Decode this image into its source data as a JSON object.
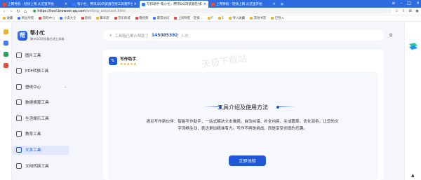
{
  "browser": {
    "tabs": [
      {
        "label": "上网导航 - 轻快上网 从这里开始",
        "active": false,
        "color": "#e94b35"
      },
      {
        "label": "帮小忙，腾讯QQ浏览器在线工具箱平台",
        "active": false,
        "color": "#3c7bff"
      },
      {
        "label": "写作助手-帮小忙，腾讯QQ浏览器在线工具",
        "active": true,
        "color": "#3c7bff"
      },
      {
        "label": "上网导航 - 轻快上网 从这里开始",
        "active": false,
        "color": "#e94b35"
      }
    ],
    "url_host": "https://tool.browser.qq.com",
    "url_path": "/writing_assistant.html",
    "bookmarks": [
      {
        "label": "收藏",
        "color": "#f2b12e"
      },
      {
        "label": "网址导航",
        "color": "#3c7bff"
      },
      {
        "label": "游戏中心",
        "color": "#e94b35"
      },
      {
        "label": "小说大全",
        "color": "#3c7bff"
      },
      {
        "label": "影视",
        "color": "#e94b35"
      },
      {
        "label": "聚享游",
        "color": "#f2b12e"
      },
      {
        "label": "京东商城",
        "color": "#e94b35"
      },
      {
        "label": "看视频",
        "color": "#e94b35"
      },
      {
        "label": "最常访问",
        "color": "#3c7bff"
      },
      {
        "label": "上网导航 - 轻快...",
        "color": "#e94b35"
      },
      {
        "label": "F",
        "color": "#f2b12e"
      },
      {
        "label": "1",
        "color": "#f2b12e"
      },
      {
        "label": "导入收藏",
        "color": "#f2b12e"
      },
      {
        "label": "其他书签",
        "color": "#f2b12e"
      },
      {
        "label": "已导入",
        "color": "#f2b12e"
      }
    ]
  },
  "brand": {
    "logo": "帮",
    "name": "帮小忙",
    "subtitle": "腾讯QQ浏览器在线工具箱"
  },
  "nav": [
    {
      "label": "图片工具",
      "active": false,
      "caret": false
    },
    {
      "label": "PDF转换工具",
      "active": false,
      "caret": false
    },
    {
      "label": "塑纸中心",
      "active": false,
      "caret": true
    },
    {
      "label": "数据换算工具",
      "active": false,
      "caret": false
    },
    {
      "label": "生活娱乐工具",
      "active": false,
      "caret": false
    },
    {
      "label": "教育工具",
      "active": false,
      "caret": false
    },
    {
      "label": "文本工具",
      "active": true,
      "caret": false
    },
    {
      "label": "文档转换工具",
      "active": false,
      "caret": false
    }
  ],
  "search": {
    "prefix": "工具箱已累计帮助了",
    "count": "145085392",
    "suffix": "人次"
  },
  "card": {
    "title": "写作助手",
    "stars": "★★★★★",
    "watermark": "天极下载站",
    "intro_title": "工具介绍及使用方法",
    "intro_text": "遇见写作新伙伴：智能写作助手，一站式解决文本难题。自动纠错、补全内容、生成篇章、优化润色，让您的文字流畅生动，表达更加精准有力。写作不再是挑战，而是享受创造的乐趣。",
    "cta": "立即体验"
  },
  "colors": {
    "accent": "#1f57d6",
    "tabbar": "#2f6ce0",
    "star": "#f3a417"
  }
}
